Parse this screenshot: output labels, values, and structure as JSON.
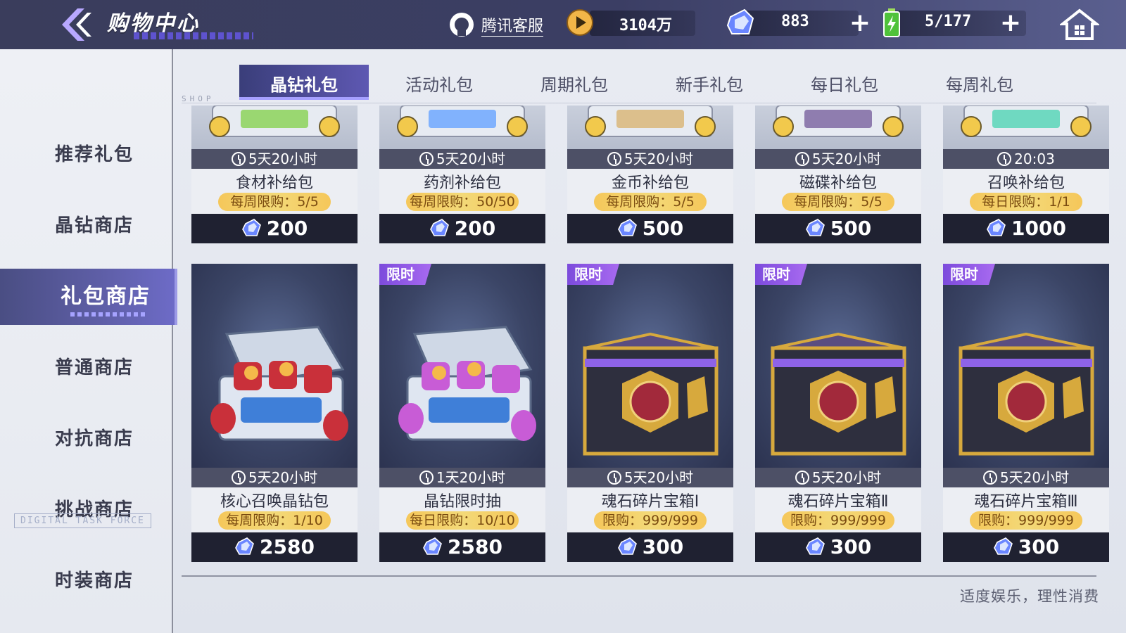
{
  "header": {
    "title": "购物中心",
    "service_label": "腾讯客服",
    "gold_value": "3104万",
    "gems_value": "883",
    "energy_value": "5/177"
  },
  "sidebar": {
    "items": [
      {
        "label": "推荐礼包",
        "active": false
      },
      {
        "label": "晶钻商店",
        "active": false
      },
      {
        "label": "礼包商店",
        "active": true
      },
      {
        "label": "普通商店",
        "active": false
      },
      {
        "label": "对抗商店",
        "active": false
      },
      {
        "label": "挑战商店",
        "active": false
      },
      {
        "label": "时装商店",
        "active": false
      }
    ],
    "deco_text": "DIGITAL TASK FORCE"
  },
  "tabs": {
    "deco": "SHOP",
    "items": [
      {
        "label": "晶钻礼包",
        "active": true
      },
      {
        "label": "活动礼包",
        "active": false
      },
      {
        "label": "周期礼包",
        "active": false
      },
      {
        "label": "新手礼包",
        "active": false
      },
      {
        "label": "每日礼包",
        "active": false
      },
      {
        "label": "每周礼包",
        "active": false
      }
    ]
  },
  "cards_row1": [
    {
      "timer": "5天20小时",
      "name": "食材补给包",
      "limit": "每周限购：5/5",
      "price": "200",
      "art_icon": "food-supply-pack-icon"
    },
    {
      "timer": "5天20小时",
      "name": "药剂补给包",
      "limit": "每周限购：50/50",
      "price": "200",
      "art_icon": "potion-supply-pack-icon"
    },
    {
      "timer": "5天20小时",
      "name": "金币补给包",
      "limit": "每周限购：5/5",
      "price": "500",
      "art_icon": "coin-supply-pack-icon"
    },
    {
      "timer": "5天20小时",
      "name": "磁碟补给包",
      "limit": "每周限购：5/5",
      "price": "500",
      "art_icon": "disk-supply-pack-icon"
    },
    {
      "timer": "20:03",
      "name": "召唤补给包",
      "limit": "每日限购：1/1",
      "price": "1000",
      "art_icon": "summon-supply-pack-icon"
    }
  ],
  "cards_row2": [
    {
      "tag": "",
      "timer": "5天20小时",
      "name": "核心召唤晶钻包",
      "limit": "每周限购：1/10",
      "price": "2580",
      "art_icon": "core-summon-chest-icon"
    },
    {
      "tag": "限时",
      "timer": "1天20小时",
      "name": "晶钻限时抽",
      "limit": "每日限购：10/10",
      "price": "2580",
      "art_icon": "limited-draw-chest-icon"
    },
    {
      "tag": "限时",
      "timer": "5天20小时",
      "name": "魂石碎片宝箱Ⅰ",
      "limit": "限购：999/999",
      "price": "300",
      "art_icon": "soulstone-chest-icon"
    },
    {
      "tag": "限时",
      "timer": "5天20小时",
      "name": "魂石碎片宝箱Ⅱ",
      "limit": "限购：999/999",
      "price": "300",
      "art_icon": "soulstone-chest-icon"
    },
    {
      "tag": "限时",
      "timer": "5天20小时",
      "name": "魂石碎片宝箱Ⅲ",
      "limit": "限购：999/999",
      "price": "300",
      "art_icon": "soulstone-chest-icon"
    }
  ],
  "footer": {
    "note": "适度娱乐，理性消费"
  },
  "colors": {
    "accent": "#5e58b2",
    "limit_badge": "#f5c75a",
    "price_bar": "#1f2131"
  }
}
